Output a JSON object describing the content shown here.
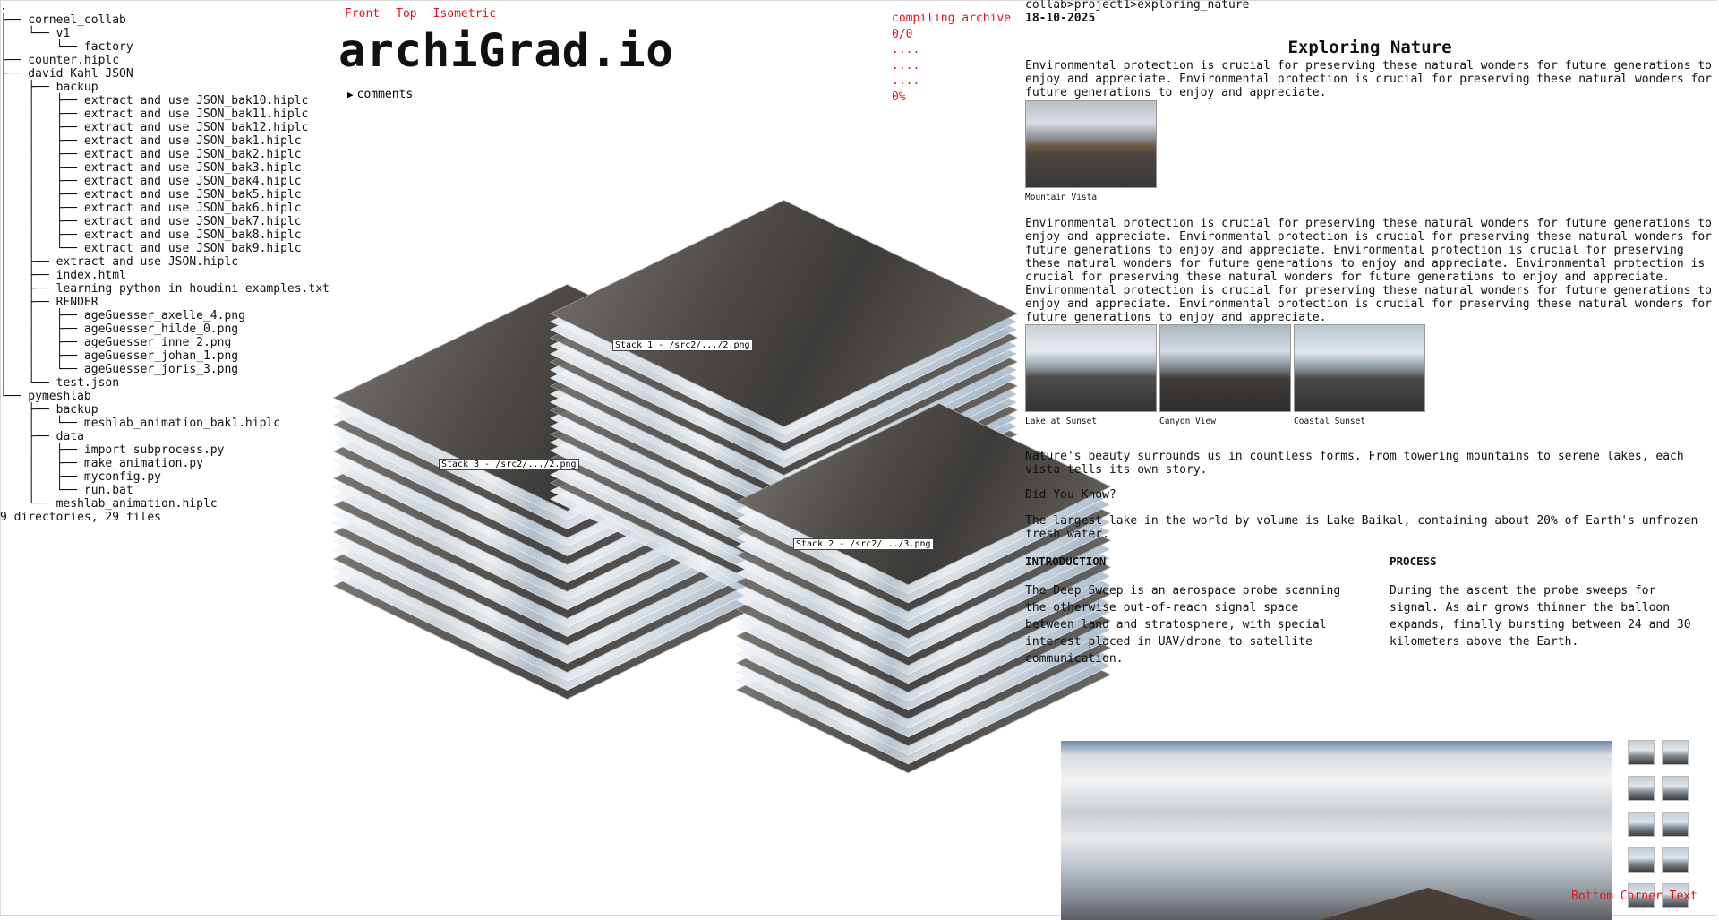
{
  "file_tree": {
    "lines": [
      ".",
      "├── corneel_collab",
      "│   └── v1",
      "│       └── factory",
      "├── counter.hiplc",
      "├── david Kahl JSON",
      "│   ├── backup",
      "│   │   ├── extract and use JSON_bak10.hiplc",
      "│   │   ├── extract and use JSON_bak11.hiplc",
      "│   │   ├── extract and use JSON_bak12.hiplc",
      "│   │   ├── extract and use JSON_bak1.hiplc",
      "│   │   ├── extract and use JSON_bak2.hiplc",
      "│   │   ├── extract and use JSON_bak3.hiplc",
      "│   │   ├── extract and use JSON_bak4.hiplc",
      "│   │   ├── extract and use JSON_bak5.hiplc",
      "│   │   ├── extract and use JSON_bak6.hiplc",
      "│   │   ├── extract and use JSON_bak7.hiplc",
      "│   │   ├── extract and use JSON_bak8.hiplc",
      "│   │   └── extract and use JSON_bak9.hiplc",
      "│   ├── extract and use JSON.hiplc",
      "│   ├── index.html",
      "│   ├── learning python in houdini examples.txt",
      "│   ├── RENDER",
      "│   │   ├── ageGuesser_axelle_4.png",
      "│   │   ├── ageGuesser_hilde_0.png",
      "│   │   ├── ageGuesser_inne_2.png",
      "│   │   ├── ageGuesser_johan_1.png",
      "│   │   └── ageGuesser_joris_3.png",
      "│   └── test.json",
      "└── pymeshlab",
      "    ├── backup",
      "    │   └── meshlab_animation_bak1.hiplc",
      "    ├── data",
      "    │   ├── import subprocess.py",
      "    │   ├── make_animation.py",
      "    │   ├── myconfig.py",
      "    │   └── run.bat",
      "    └── meshlab_animation.hiplc",
      "9 directories, 29 files"
    ]
  },
  "view_tabs": [
    "Front",
    "Top",
    "Isometric"
  ],
  "logo": "archiGrad.io",
  "comments_label": "comments",
  "status": {
    "line1": "compiling archive",
    "line2": "0/0",
    "line3": "....",
    "line4": "....",
    "line5": "....",
    "line6": "0%"
  },
  "stacks": {
    "stack1": "Stack 1 - /src2/.../2.png",
    "stack2": "Stack 2 - /src2/.../3.png",
    "stack3": "Stack 3 - /src2/.../2.png"
  },
  "article": {
    "breadcrumb": "collab>project1>exploring_nature",
    "date": "18-10-2025",
    "title": "Exploring Nature",
    "para1": "Environmental protection is crucial for preserving these natural wonders for future generations to enjoy and appreciate. Environmental protection is crucial for preserving these natural wonders for future generations to enjoy and appreciate.",
    "image1_caption": "Mountain Vista",
    "para2": "Environmental protection is crucial for preserving these natural wonders for future generations to enjoy and appreciate. Environmental protection is crucial for preserving these natural wonders for future generations to enjoy and appreciate. Environmental protection is crucial for preserving these natural wonders for future generations to enjoy and appreciate. Environmental protection is crucial for preserving these natural wonders for future generations to enjoy and appreciate. Environmental protection is crucial for preserving these natural wonders for future generations to enjoy and appreciate. Environmental protection is crucial for preserving these natural wonders for future generations to enjoy and appreciate.",
    "gallery_captions": [
      "Lake at Sunset",
      "Canyon View",
      "Coastal Sunset"
    ],
    "para3": "Nature's beauty surrounds us in countless forms. From towering mountains to serene lakes, each vista tells its own story.",
    "did_you_know": "Did You Know?",
    "fact": "The largest lake in the world by volume is Lake Baikal, containing about 20% of Earth's unfrozen fresh water.",
    "intro_heading": "INTRODUCTION",
    "intro_text": "The Deep Sweep is an aerospace probe scanning the otherwise out-of-reach signal space between land and stratosphere, with special interest placed in UAV/drone to satellite communication.",
    "process_heading": "PROCESS",
    "process_text": "During the ascent the probe sweeps for signal. As air grows thinner the balloon expands, finally bursting between 24 and 30 kilometers above the Earth."
  },
  "corner_text": "Bottom Corner Text"
}
